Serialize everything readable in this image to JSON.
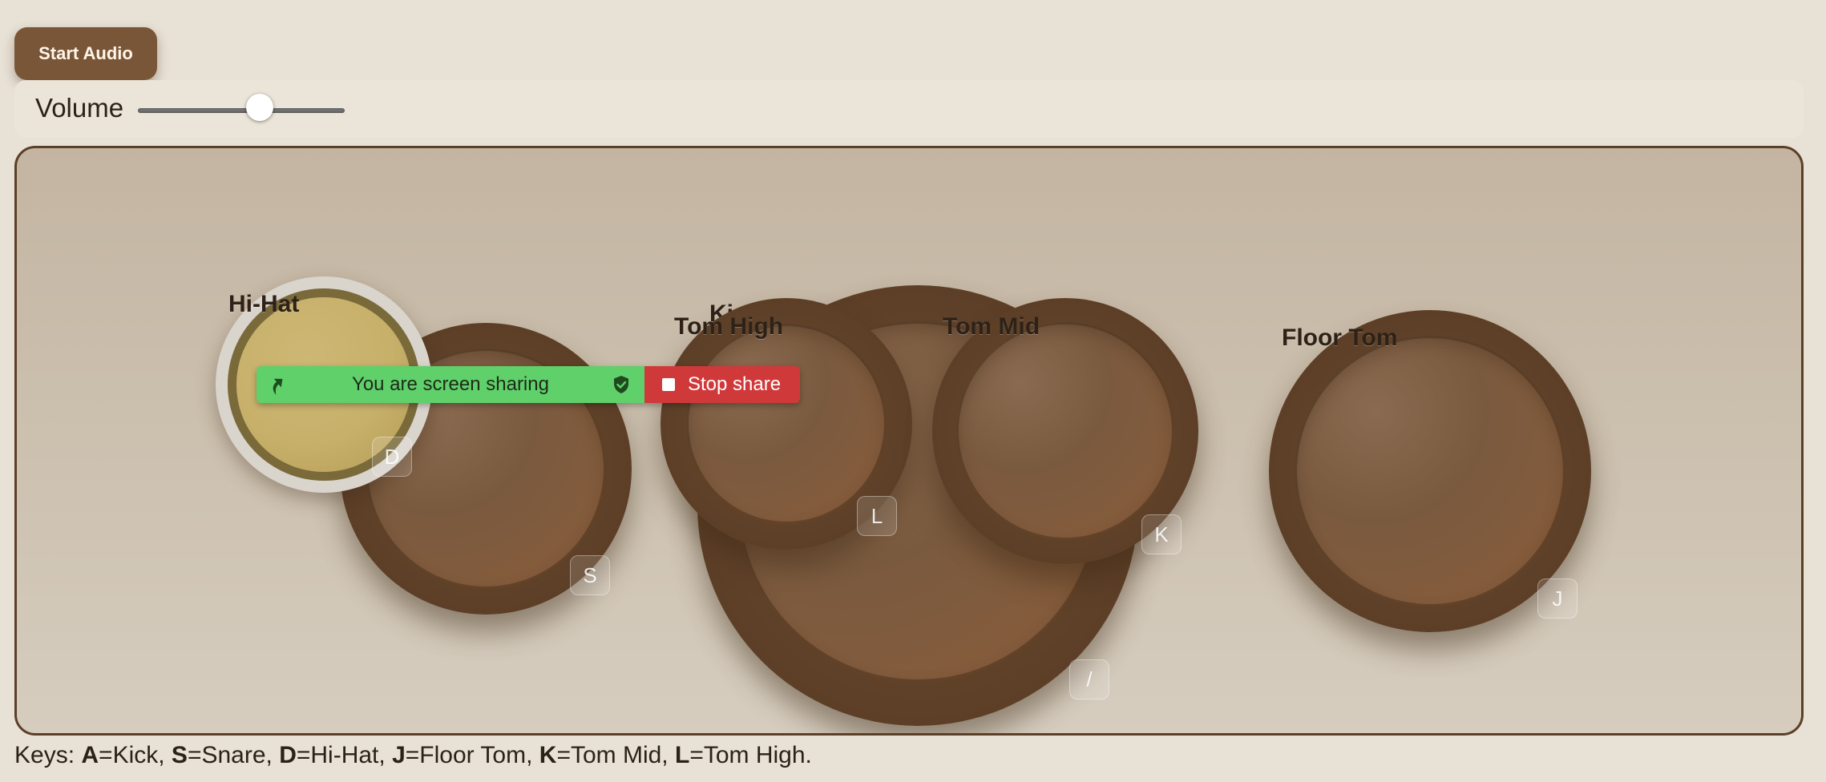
{
  "controls": {
    "start_audio_label": "Start Audio",
    "volume_label": "Volume",
    "volume_value": 0.59
  },
  "drums": {
    "kick": {
      "label": "Ki",
      "key": "/"
    },
    "snare": {
      "key": "S"
    },
    "hihat": {
      "label": "Hi-Hat",
      "key": "D"
    },
    "tom_high": {
      "label": "Tom High",
      "key": "L"
    },
    "tom_mid": {
      "label": "Tom Mid",
      "key": "K"
    },
    "floor_tom": {
      "label": "Floor Tom",
      "key": "J"
    }
  },
  "screen_share": {
    "message": "You are screen sharing",
    "stop_label": "Stop share",
    "accent_green": "#5fd06a",
    "accent_red": "#d0393a"
  },
  "keys_legend": [
    {
      "key": "A",
      "text": "=Kick, "
    },
    {
      "key": "S",
      "text": "=Snare, "
    },
    {
      "key": "D",
      "text": "=Hi-Hat, "
    },
    {
      "key": "J",
      "text": "=Floor Tom, "
    },
    {
      "key": "K",
      "text": "=Tom Mid, "
    },
    {
      "key": "L",
      "text": "=Tom High."
    }
  ],
  "keys_prefix": "Keys: ",
  "colors": {
    "background": "#e8e1d5",
    "wood": "#5d3f27",
    "button": "#7a5638",
    "kit_border": "#5c3f27"
  }
}
